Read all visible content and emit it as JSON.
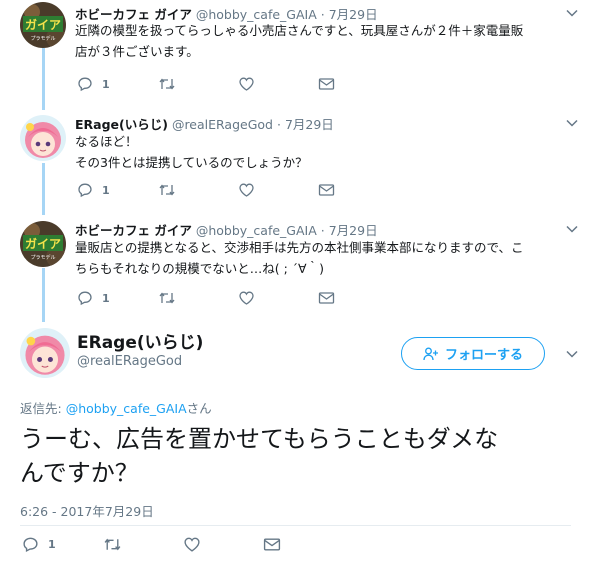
{
  "replies": [
    {
      "display_name": "ホビーカフェ ガイア",
      "handle": "@hobby_cafe_GAIA",
      "date": "7月29日",
      "lines": [
        "近隣の模型を扱ってらっしゃる小売店さんですと、玩具屋さんが２件＋家電量販",
        "店が３件ございます。"
      ],
      "reply_count": "1",
      "avatar": "hobby-cafe-gaia-logo"
    },
    {
      "display_name": "ERage(いらじ)",
      "handle": "@realERageGod",
      "date": "7月29日",
      "lines": [
        "なるほど！",
        "その3件とは提携しているのでしょうか？"
      ],
      "reply_count": "1",
      "avatar": "erage-anime-avatar"
    },
    {
      "display_name": "ホビーカフェ ガイア",
      "handle": "@hobby_cafe_GAIA",
      "date": "7月29日",
      "lines": [
        "量販店との提携となると、交渉相手は先方の本社側事業本部になりますので、こ",
        "ちらもそれなりの規模でないと…ね( ; ´∀｀)"
      ],
      "reply_count": "1",
      "avatar": "hobby-cafe-gaia-logo"
    }
  ],
  "separator": "·",
  "main_tweet": {
    "display_name": "ERage(いらじ)",
    "handle": "@realERageGod",
    "follow_label": "フォローする",
    "replying_prefix": "返信先:",
    "replying_mention": "@hobby_cafe_GAIA",
    "replying_suffix": "さん",
    "text_line1": "うーむ、広告を置かせてもらうこともダメな",
    "text_line2": "んですか？",
    "timestamp": "6:26 - 2017年7月29日",
    "reply_count": "1"
  },
  "colors": {
    "accent": "#1da1f2",
    "muted": "#657786",
    "thread_line": "#a6d5f5"
  }
}
